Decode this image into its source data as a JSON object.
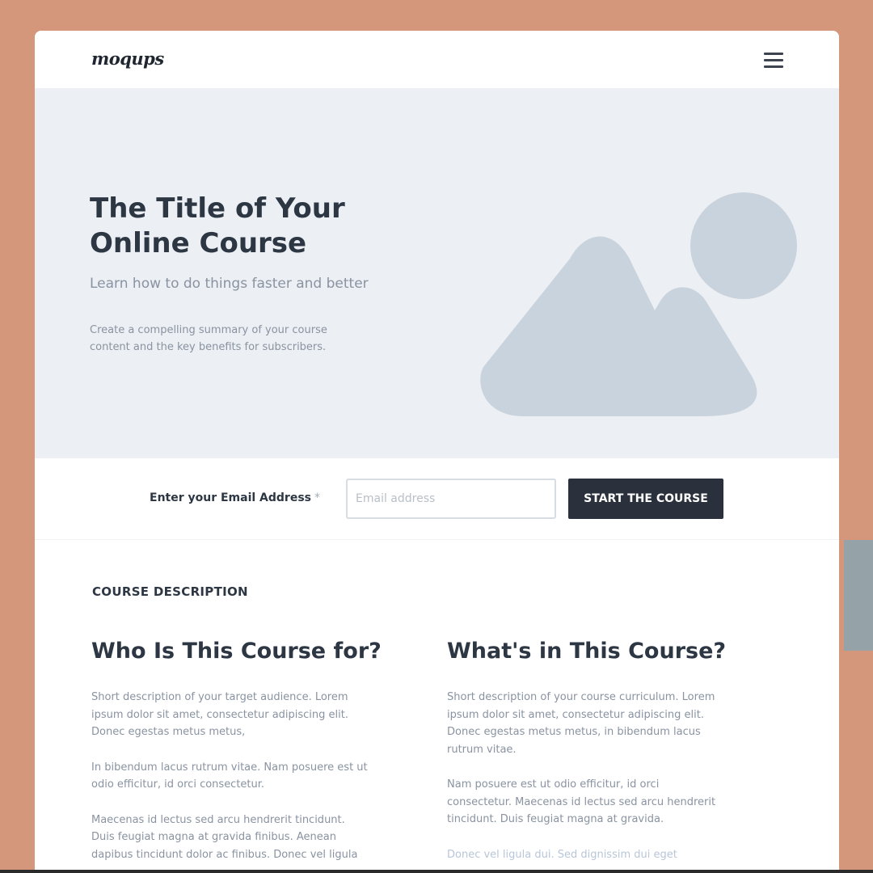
{
  "header": {
    "logo_text": "moqups",
    "menu_icon": "hamburger-menu-icon"
  },
  "hero": {
    "title": "The Title of Your Online Course",
    "subtitle": "Learn how to do things faster and better",
    "description": "Create a compelling summary of your course content and the key benefits for subscribers.",
    "image_icon": "mountain-placeholder-icon"
  },
  "signup": {
    "label": "Enter your Email Address",
    "required_mark": "*",
    "email_placeholder": "Email address",
    "email_value": "",
    "button_label": "START THE COURSE"
  },
  "course": {
    "section_label": "COURSE DESCRIPTION",
    "left": {
      "heading": "Who Is This Course for?",
      "paragraphs": [
        "Short description of your target audience. Lorem ipsum dolor sit amet, consectetur adipiscing elit. Donec egestas metus metus,",
        "In bibendum lacus rutrum vitae.  Nam posuere est ut odio efficitur, id orci consectetur.",
        "Maecenas id lectus sed arcu hendrerit tincidunt. Duis feugiat magna at gravida finibus. Aenean dapibus tincidunt dolor ac finibus. Donec vel ligula"
      ]
    },
    "right": {
      "heading": "What's in This Course?",
      "paragraphs": [
        "Short description of your course curriculum. Lorem ipsum dolor sit amet, consectetur adipiscing elit. Donec egestas metus metus, in bibendum lacus rutrum vitae.",
        "Nam posuere est ut odio efficitur, id orci consectetur. Maecenas id lectus sed arcu hendrerit tincidunt. Duis feugiat magna at gravida.",
        "Donec vel ligula dui. Sed dignissim dui eget"
      ]
    }
  },
  "colors": {
    "background": "#d4977b",
    "hero_background": "#eceff3",
    "placeholder_shape": "#c9d3dd",
    "button_background": "#2b313c",
    "heading_text": "#2d3744",
    "body_text": "#8993a1"
  }
}
